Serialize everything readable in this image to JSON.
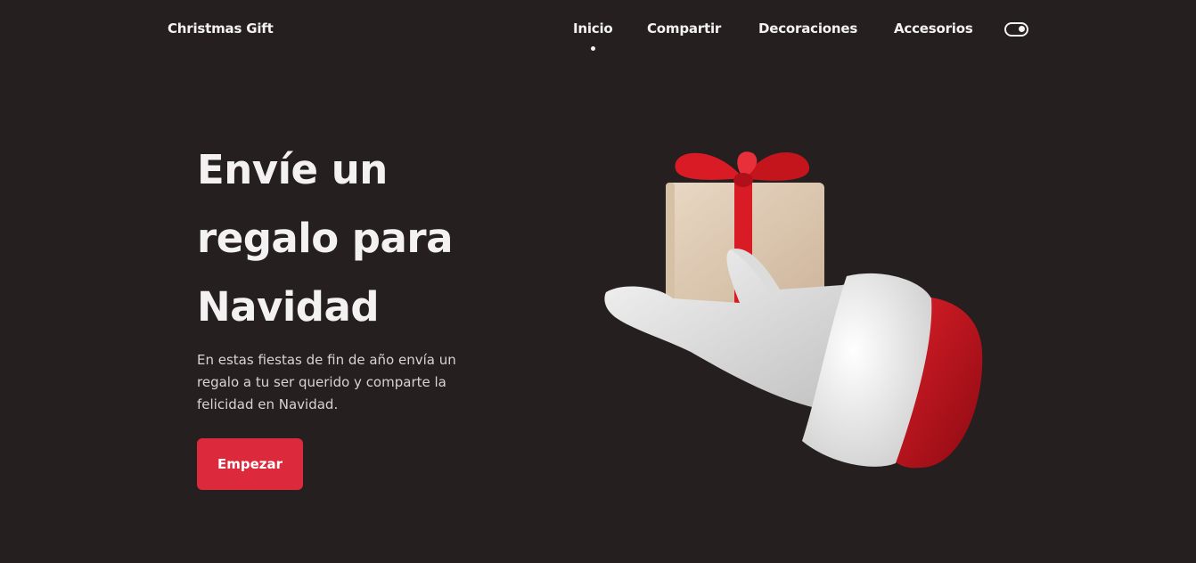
{
  "header": {
    "logo": "Christmas Gift",
    "nav": [
      {
        "label": "Inicio",
        "active": true
      },
      {
        "label": "Compartir",
        "active": false
      },
      {
        "label": "Decoraciones",
        "active": false
      },
      {
        "label": "Accesorios",
        "active": false
      }
    ],
    "theme_toggle_icon": "toggle-icon"
  },
  "hero": {
    "title_lines": [
      "Envíe un",
      "regalo para",
      "Navidad"
    ],
    "description_lines": [
      "En estas fiestas de fin de año envía un",
      "regalo a tu ser querido y comparte la",
      "felicidad en Navidad."
    ],
    "cta_label": "Empezar",
    "image": "santa-glove-holding-gift"
  },
  "colors": {
    "background": "#251f20",
    "text": "#f3f1f1",
    "accent": "#dc2a3c"
  }
}
